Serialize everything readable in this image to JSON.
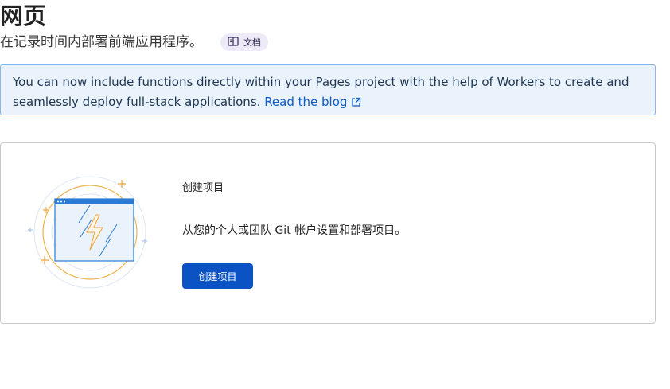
{
  "header": {
    "title": "网页",
    "subtitle": "在记录时间内部署前端应用程序。",
    "docs_label": "文档",
    "docs_icon": "book-icon"
  },
  "banner": {
    "text": "You can now include functions directly within your Pages project with the help of Workers to create and seamlessly deploy full-stack applications.",
    "link_label": "Read the blog",
    "link_icon": "external-link-icon"
  },
  "card": {
    "title": "创建项目",
    "description": "从您的个人或团队 Git 帐户设置和部署项目。",
    "button_label": "创建项目",
    "illustration": "browser-window-lightning-illustration"
  },
  "colors": {
    "accent": "#0b53c4",
    "banner_bg": "#eaf2fc",
    "banner_border": "#8bb5e8",
    "chip_bg": "#efeaf8",
    "illustration_orange": "#f0a640"
  }
}
